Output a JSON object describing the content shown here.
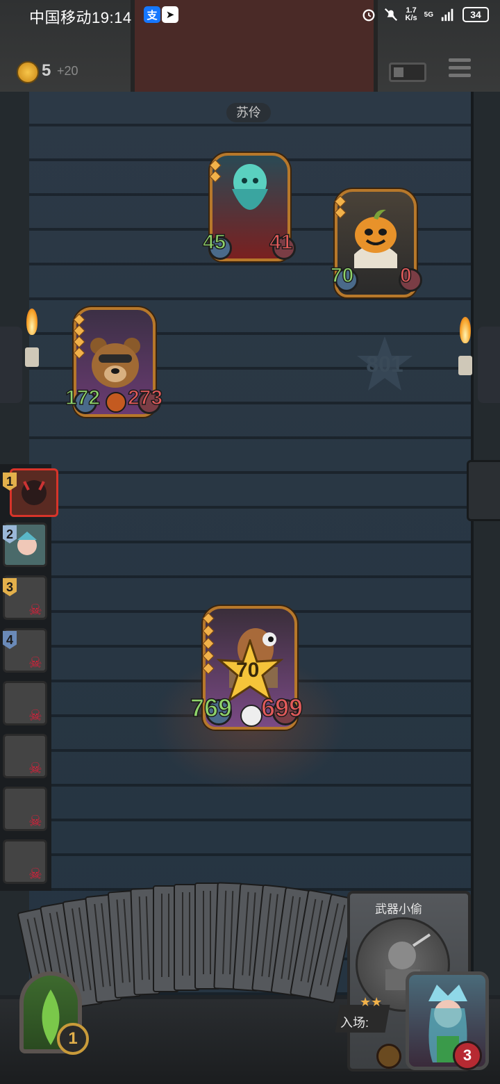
{
  "status_bar": {
    "carrier_time": "中国移动19:14",
    "app_icons": [
      "alipay-icon",
      "messenger-icon"
    ],
    "net_speed_value": "1.7",
    "net_speed_unit": "K/s",
    "network": "5G",
    "battery": "34"
  },
  "hud": {
    "coins": "5",
    "coin_bonus": "+20",
    "enemy_name": "苏伶"
  },
  "enemy_cards": [
    {
      "name": "ghost-card",
      "attack": "45",
      "health": "41"
    },
    {
      "name": "pumpkin-card",
      "attack": "70",
      "health": "0"
    },
    {
      "name": "bear-card",
      "attack": "172",
      "health": "273"
    }
  ],
  "board_marker": "801",
  "player_card": {
    "damage": "70",
    "attack": "769",
    "health": "699"
  },
  "queue": [
    {
      "num": "1"
    },
    {
      "num": "2"
    },
    {
      "num": "3"
    },
    {
      "num": "4"
    },
    {
      "num": ""
    },
    {
      "num": ""
    },
    {
      "num": ""
    },
    {
      "num": ""
    }
  ],
  "hand": {
    "title": "武器小偷",
    "enter_label": "入场:"
  },
  "mana": "1",
  "hero_health": "3"
}
